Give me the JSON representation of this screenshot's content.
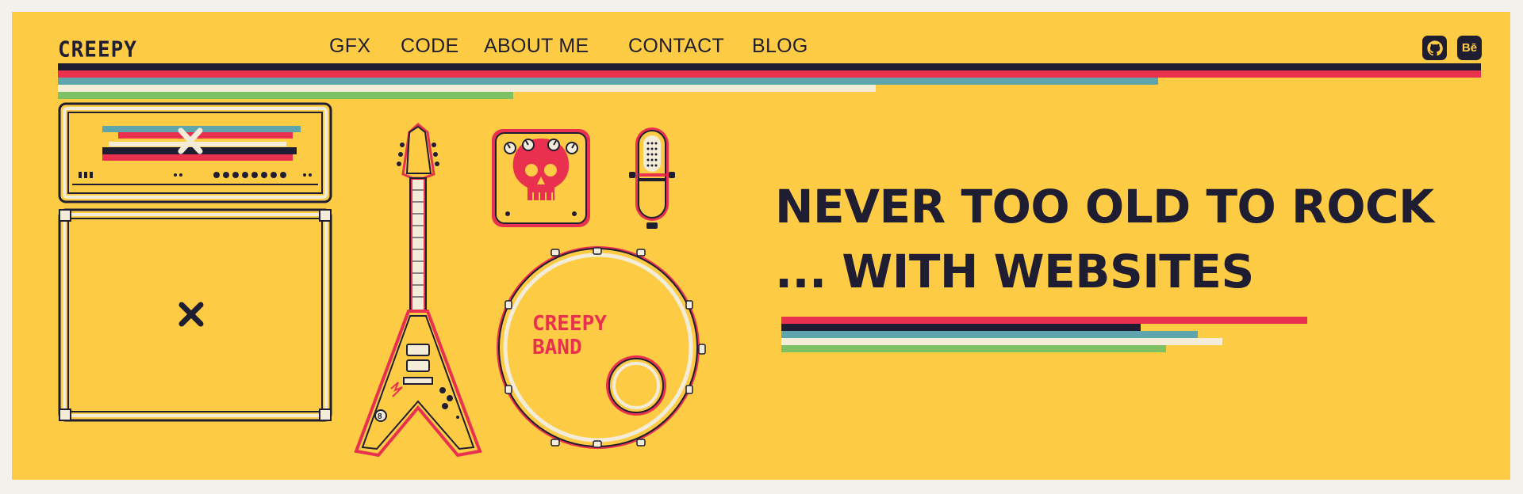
{
  "header": {
    "logo": "CREEPY",
    "nav": [
      {
        "label": "GFX"
      },
      {
        "label": "CODE"
      },
      {
        "label": "ABOUT ME"
      },
      {
        "label": "CONTACT"
      },
      {
        "label": "BLOG"
      }
    ],
    "social": [
      {
        "icon": "github-icon",
        "label": ""
      },
      {
        "icon": "behance-icon",
        "label": "Bē"
      }
    ]
  },
  "hero": {
    "line1": "NEVER TOO OLD TO ROCK",
    "line2": "... WITH WEBSITES"
  },
  "illustration": {
    "drum_text_line1": "CREEPY",
    "drum_text_line2": "BAND"
  },
  "colors": {
    "background": "#fdcc44",
    "dark": "#1f1d31",
    "red": "#e9304f",
    "teal": "#5fa5ae",
    "cream": "#f2ecd9",
    "green": "#7ec064"
  }
}
